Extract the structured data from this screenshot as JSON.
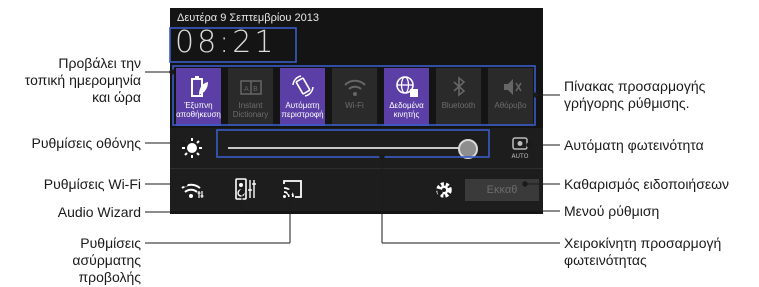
{
  "status": {
    "date": "Δευτέρα 9 Σεπτεμβρίου 2013",
    "time": "08:21"
  },
  "quick_settings": [
    {
      "label1": "Έξυπνη",
      "label2": "αποθήκευση",
      "icon": "leaf-battery-icon",
      "active": true
    },
    {
      "label1": "Instant",
      "label2": "Dictionary",
      "icon": "dictionary-icon",
      "active": false
    },
    {
      "label1": "Αυτόματη",
      "label2": "περιστροφή",
      "icon": "auto-rotate-icon",
      "active": true
    },
    {
      "label1": "Wi-Fi",
      "label2": "",
      "icon": "wifi-icon",
      "active": false
    },
    {
      "label1": "Δεδομένα",
      "label2": "κινητής",
      "icon": "mobile-data-icon",
      "active": true
    },
    {
      "label1": "Bluetooth",
      "label2": "",
      "icon": "bluetooth-icon",
      "active": false
    },
    {
      "label1": "Αθόρυβο",
      "label2": "",
      "icon": "mute-icon",
      "active": false
    }
  ],
  "brightness": {
    "level_percent": 100,
    "auto_label": "AUTO"
  },
  "clear_button": "Εκκαθ",
  "annotations": {
    "date_time": [
      "Προβάλει την",
      "τοπική ημερομηνία",
      "και ώρα"
    ],
    "display": "Ρυθμίσεις οθόνης",
    "wifi": "Ρυθμίσεις Wi-Fi",
    "audio": "Audio Wizard",
    "wireless": [
      "Ρυθμίσεις",
      "ασύρματης",
      "προβολής"
    ],
    "quick_panel": [
      "Πίνακας προσαρμογής",
      "γρήγορης ρύθμισης."
    ],
    "auto_brightness": "Αυτόματη φωτεινότητα",
    "clear": "Καθαρισμός ειδοποιήσεων",
    "settings_menu": "Μενού ρύθμιση",
    "manual_brightness": [
      "Χειροκίνητη προσαρμογή",
      "φωτεινότητας"
    ]
  },
  "colors": {
    "active_tile": "#5b3fa6",
    "highlight_box": "#3a5cc8",
    "background": "#141414"
  }
}
